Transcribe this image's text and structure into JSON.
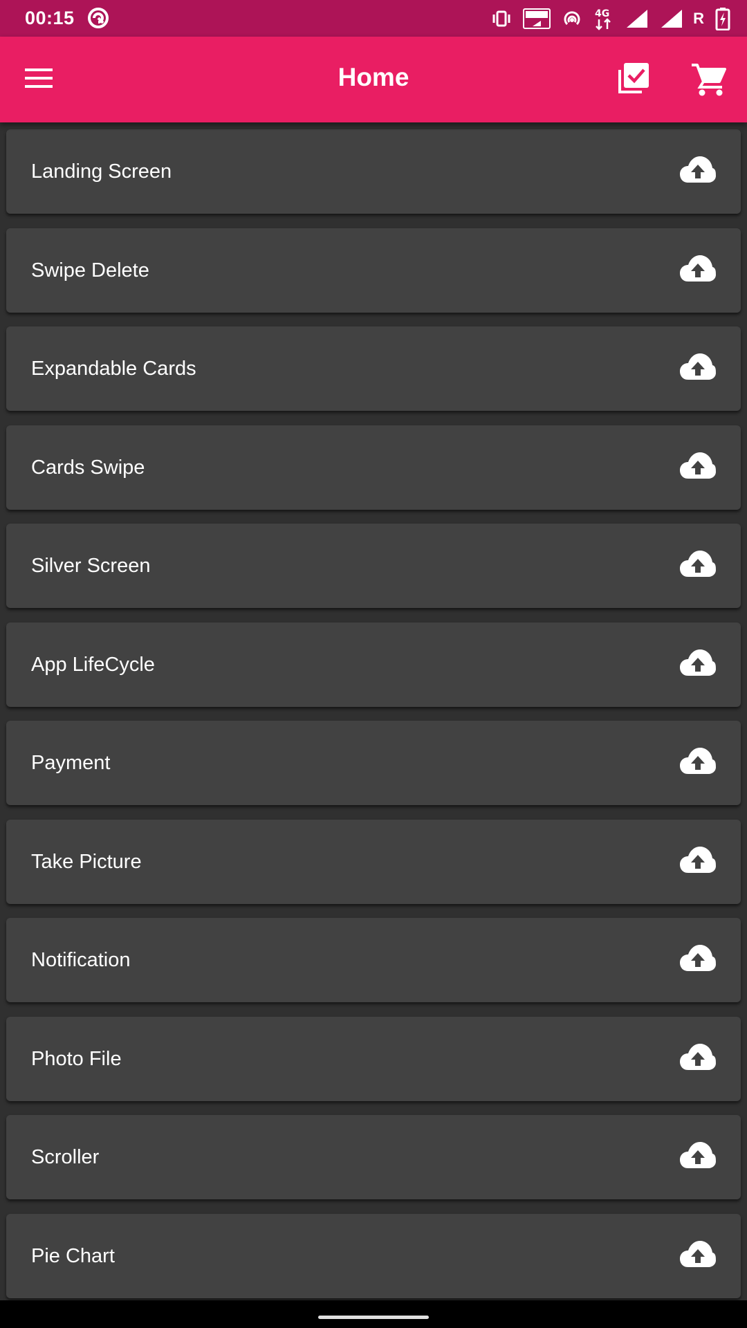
{
  "status_bar": {
    "time": "00:15",
    "roaming_indicator": "R",
    "icons": [
      "app-notification-icon",
      "vibrate-icon",
      "volte-icon",
      "hotspot-icon",
      "4g-data-icon",
      "signal-icon",
      "signal-icon",
      "battery-charging-icon"
    ],
    "background_color": "#ad1457"
  },
  "app_bar": {
    "title": "Home",
    "left_icon": "menu-icon",
    "right_icons": [
      "checklist-icon",
      "cart-icon"
    ],
    "background_color": "#e91e63"
  },
  "list": {
    "items": [
      {
        "label": "Landing Screen",
        "icon": "cloud-upload-icon"
      },
      {
        "label": "Swipe Delete",
        "icon": "cloud-upload-icon"
      },
      {
        "label": "Expandable Cards",
        "icon": "cloud-upload-icon"
      },
      {
        "label": "Cards Swipe",
        "icon": "cloud-upload-icon"
      },
      {
        "label": "Silver Screen",
        "icon": "cloud-upload-icon"
      },
      {
        "label": "App LifeCycle",
        "icon": "cloud-upload-icon"
      },
      {
        "label": "Payment",
        "icon": "cloud-upload-icon"
      },
      {
        "label": "Take Picture",
        "icon": "cloud-upload-icon"
      },
      {
        "label": "Notification",
        "icon": "cloud-upload-icon"
      },
      {
        "label": "Photo File",
        "icon": "cloud-upload-icon"
      },
      {
        "label": "Scroller",
        "icon": "cloud-upload-icon"
      },
      {
        "label": "Pie Chart",
        "icon": "cloud-upload-icon"
      }
    ],
    "card_color": "#424242",
    "background_color": "#303030"
  }
}
